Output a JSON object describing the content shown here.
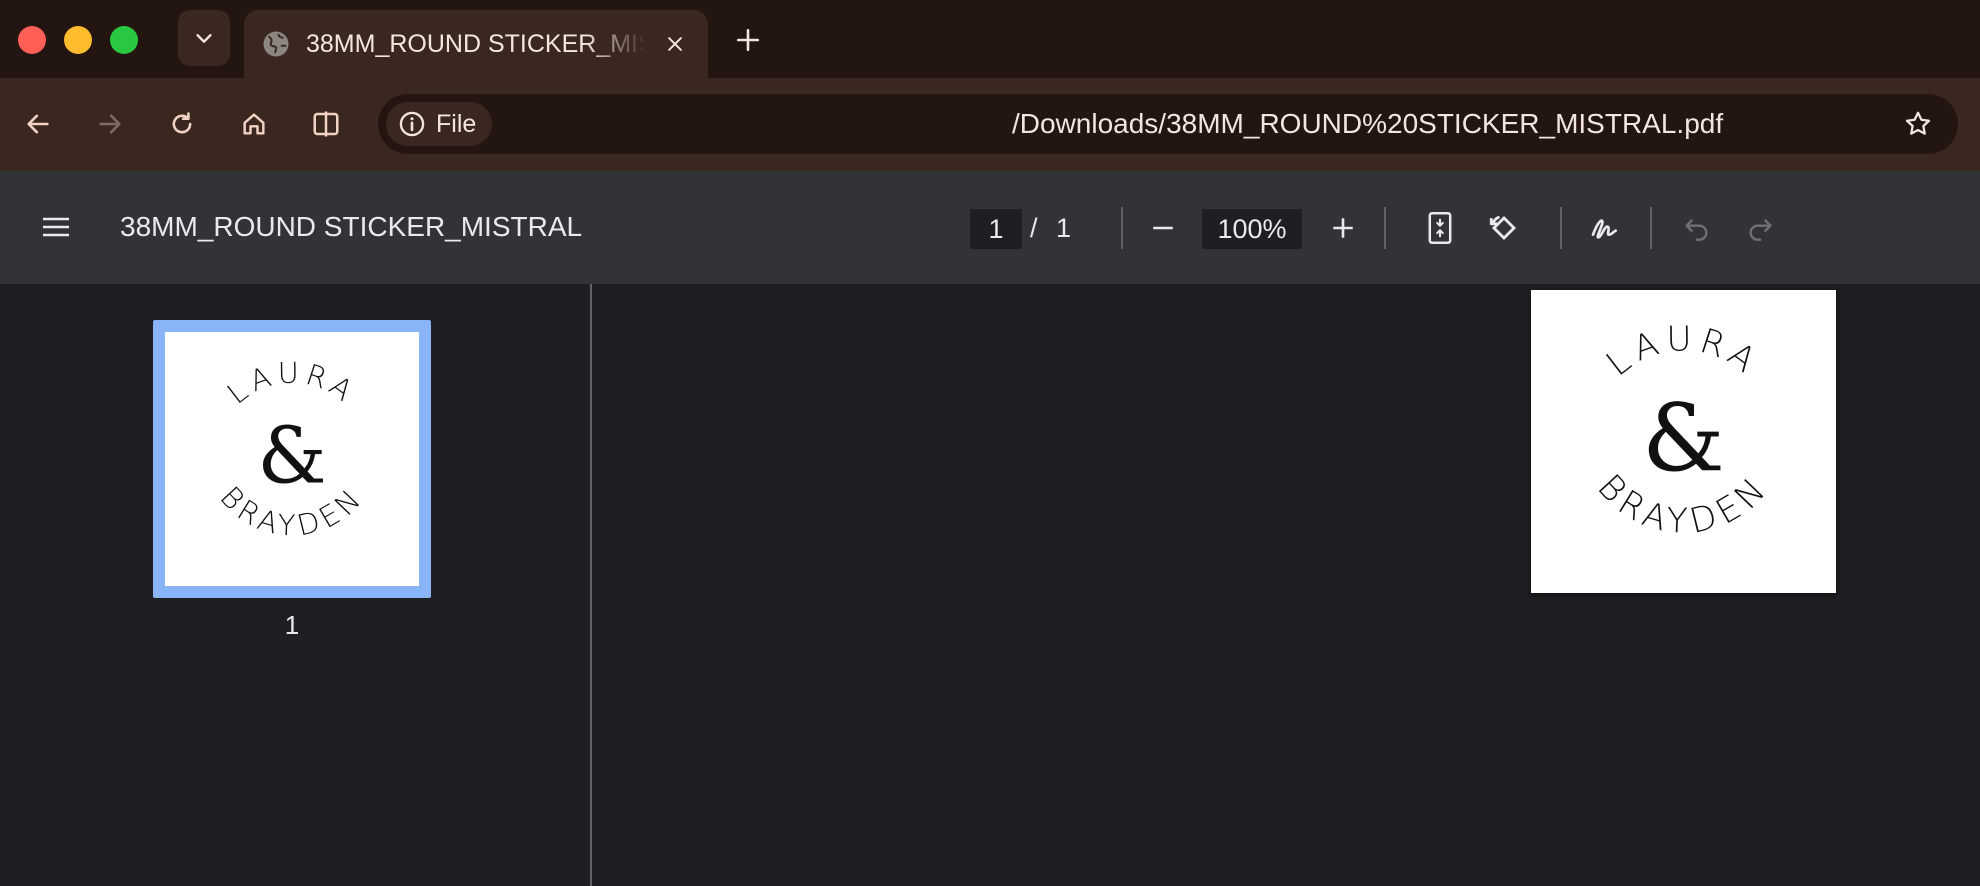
{
  "browser": {
    "tab": {
      "title": "38MM_ROUND STICKER_MISTRAL",
      "favicon": "globe-icon"
    },
    "toolbar": {
      "site_chip_label": "File",
      "url": "/Downloads/38MM_ROUND%20STICKER_MISTRAL.pdf"
    },
    "colors": {
      "tabstrip": "#23150f",
      "toolbar": "#3a2820",
      "traffic_red": "#fe5f57",
      "traffic_yellow": "#febc2e",
      "traffic_green": "#28c840"
    }
  },
  "pdf": {
    "title": "38MM_ROUND STICKER_MISTRAL",
    "current_page": "1",
    "separator": "/",
    "total_pages": "1",
    "zoom": "100%",
    "thumbnails": [
      {
        "label": "1",
        "selected": true
      }
    ],
    "accent": "#8ab4f8"
  },
  "sticker": {
    "top_text": "LAURA",
    "middle_text": "&",
    "bottom_text": "BRAYDEN"
  }
}
